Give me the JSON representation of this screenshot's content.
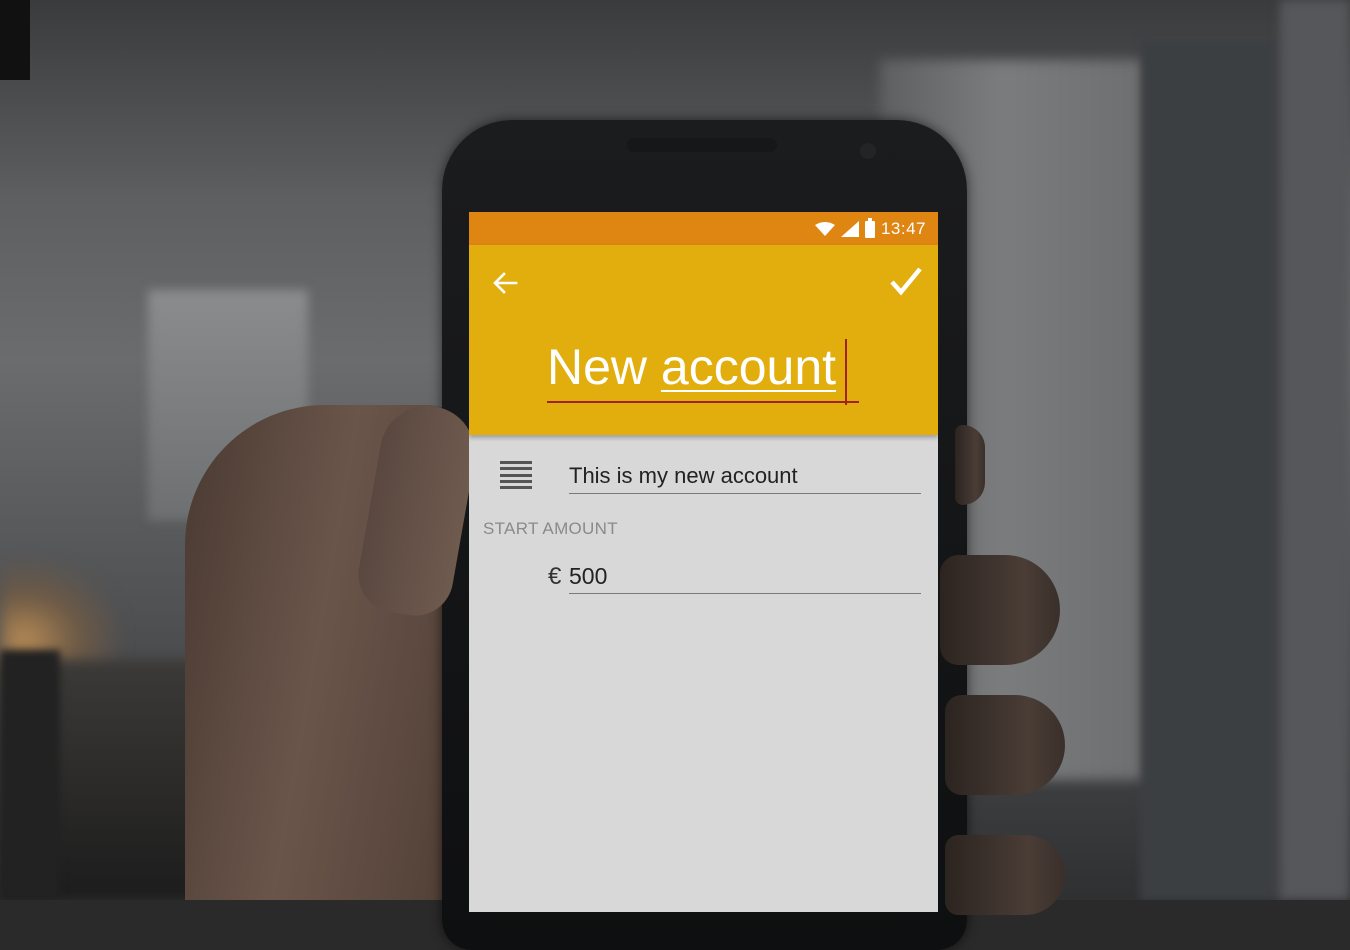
{
  "status_bar": {
    "time": "13:47",
    "icons": [
      "wifi-icon",
      "signal-icon",
      "battery-icon"
    ]
  },
  "app_bar": {
    "back_icon": "arrow-back-icon",
    "save_icon": "checkmark-icon",
    "title_part1": "New ",
    "title_part2": "account",
    "color": "#e2ae0e"
  },
  "form": {
    "description_icon": "notes-icon",
    "description_value": "This is my new account",
    "start_amount_label": "START AMOUNT",
    "currency_symbol": "€",
    "start_amount_value": "500"
  },
  "colors": {
    "status_bar": "#de8512",
    "app_bar": "#e2ae0e",
    "accent_underline": "#a0221a",
    "form_background": "#d8d8d8"
  }
}
